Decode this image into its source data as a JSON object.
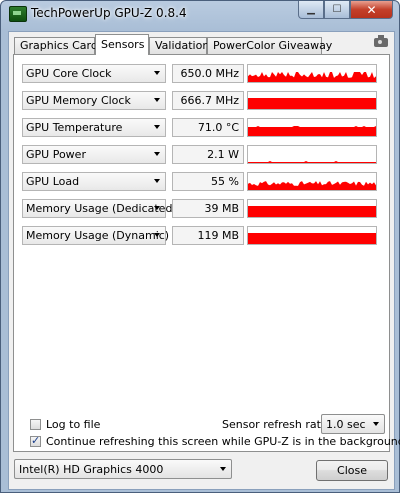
{
  "window": {
    "title": "TechPowerUp GPU-Z 0.8.4"
  },
  "tabs": [
    {
      "label": "Graphics Card",
      "active": false
    },
    {
      "label": "Sensors",
      "active": true
    },
    {
      "label": "Validation",
      "active": false
    },
    {
      "label": "PowerColor Giveaway",
      "active": false
    }
  ],
  "sensors": [
    {
      "name": "GPU Core Clock",
      "value": "650.0 MHz",
      "graph": "spiky"
    },
    {
      "name": "GPU Memory Clock",
      "value": "666.7 MHz",
      "graph": "full"
    },
    {
      "name": "GPU Temperature",
      "value": "71.0 °C",
      "graph": "high"
    },
    {
      "name": "GPU Power",
      "value": "2.1 W",
      "graph": "low"
    },
    {
      "name": "GPU Load",
      "value": "55 %",
      "graph": "load"
    },
    {
      "name": "Memory Usage (Dedicated)",
      "value": "39 MB",
      "graph": "full"
    },
    {
      "name": "Memory Usage (Dynamic)",
      "value": "119 MB",
      "graph": "full"
    }
  ],
  "options": {
    "log_to_file": {
      "label": "Log to file",
      "checked": false
    },
    "continue_refresh": {
      "label": "Continue refreshing this screen while GPU-Z is in the background",
      "checked": true
    },
    "refresh_rate_label": "Sensor refresh rate:",
    "refresh_rate_value": "1.0 sec"
  },
  "footer": {
    "gpu_select": "Intel(R) HD Graphics 4000",
    "close_label": "Close"
  },
  "colors": {
    "graph": "#ff0000"
  }
}
